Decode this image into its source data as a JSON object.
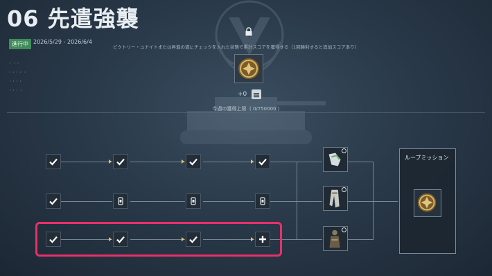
{
  "header": {
    "title": "06 先遣強襲",
    "status": "進行中",
    "date_range": "2026/5/29 - 2026/6/4",
    "description": "ビクトリー・ユナイトまたは昇進の道にチェックを入れた状態で累計スコアを獲得する（1回勝利すると追加スコアあり）"
  },
  "reward": {
    "score": "+0",
    "weekly_cap_label": "今週の獲得上限",
    "weekly_cap_value": "( 0/750000 )"
  },
  "side_labels": [
    "・ ・・",
    "・・・・ ・",
    "・・・・",
    "・・・ ・"
  ],
  "grid": {
    "rows": [
      {
        "nodes": [
          "check-icon",
          "check-icon",
          "check-icon",
          "check-icon"
        ],
        "reward_icon": "reward-boots-icon"
      },
      {
        "nodes": [
          "check-icon",
          "gear-pack-icon",
          "gear-pack-icon",
          "gear-pack-icon"
        ],
        "reward_icon": "reward-leg-armor-icon"
      },
      {
        "nodes": [
          "check-icon",
          "check-icon",
          "check-icon",
          "plus-icon"
        ],
        "reward_icon": "reward-soldier-icon"
      }
    ],
    "highlighted_row": 3
  },
  "loop_mission": {
    "title": "ループミッション"
  },
  "colors": {
    "accent": "#e3c86a",
    "status_green": "#3f8b5a",
    "highlight": "#e8306a"
  }
}
